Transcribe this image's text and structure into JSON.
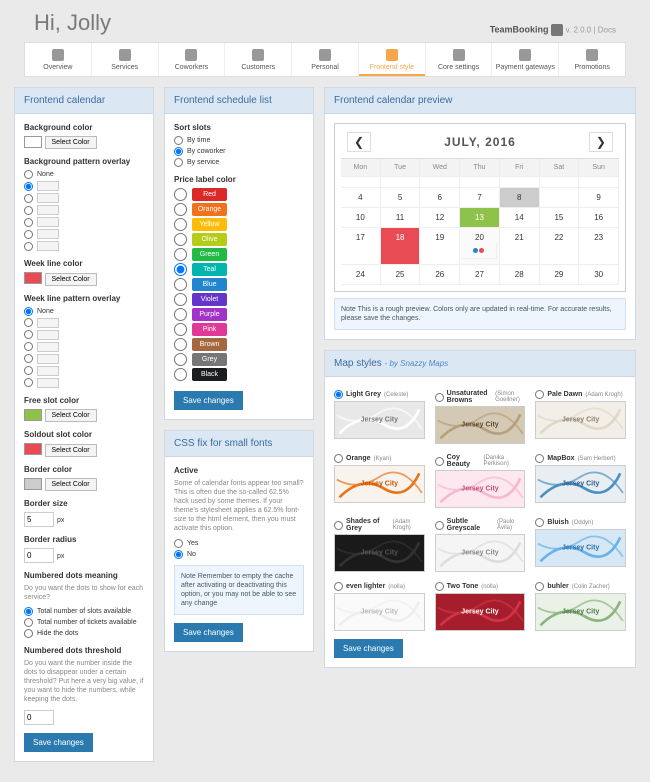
{
  "header": {
    "greeting": "Hi, Jolly",
    "brand": "TeamBooking",
    "version": "v. 2.0.0 | Docs"
  },
  "tabs": [
    "Overview",
    "Services",
    "Coworkers",
    "Customers",
    "Personal",
    "Frontend style",
    "Core settings",
    "Payment gateways",
    "Promotions"
  ],
  "activeTab": 5,
  "fcal": {
    "title": "Frontend calendar",
    "bg_label": "Background color",
    "select": "Select Color",
    "pattern_label": "Background pattern overlay",
    "none": "None",
    "wlc_label": "Week line color",
    "wlp_label": "Week line pattern overlay",
    "free_label": "Free slot color",
    "sold_label": "Soldout slot color",
    "border_label": "Border color",
    "bsize_label": "Border size",
    "bsize_val": "5",
    "px": "px",
    "brad_label": "Border radius",
    "brad_val": "0",
    "dots_label": "Numbered dots meaning",
    "dots_hint": "Do you want the dots to show for each service?",
    "dots_opts": [
      "Total number of slots available",
      "Total number of tickets available",
      "Hide the dots"
    ],
    "thresh_label": "Numbered dots threshold",
    "thresh_hint": "Do you want the number inside the dots to disappear under a certain threshold? Put here a very big value, if you want to hide the numbers, while keeping the dots.",
    "thresh_val": "0",
    "save": "Save changes"
  },
  "fsl": {
    "title": "Frontend schedule list",
    "sort_label": "Sort slots",
    "sort_opts": [
      "By time",
      "By coworker",
      "By service"
    ],
    "price_label": "Price label color",
    "colors": [
      {
        "n": "Red",
        "c": "#db2828"
      },
      {
        "n": "Orange",
        "c": "#f2711c"
      },
      {
        "n": "Yellow",
        "c": "#fbbd08"
      },
      {
        "n": "Olive",
        "c": "#b5cc18"
      },
      {
        "n": "Green",
        "c": "#21ba45"
      },
      {
        "n": "Teal",
        "c": "#00b5ad"
      },
      {
        "n": "Blue",
        "c": "#2185d0"
      },
      {
        "n": "Violet",
        "c": "#6435c9"
      },
      {
        "n": "Purple",
        "c": "#a333c8"
      },
      {
        "n": "Pink",
        "c": "#e03997"
      },
      {
        "n": "Brown",
        "c": "#a5673f"
      },
      {
        "n": "Grey",
        "c": "#767676"
      },
      {
        "n": "Black",
        "c": "#1b1c1d"
      }
    ],
    "save": "Save changes"
  },
  "css": {
    "title": "CSS fix for small fonts",
    "active_label": "Active",
    "desc": "Some of calendar fonts appear too small? This is often due the so-called 62.5% hack used by some themes. If your theme's stylesheet applies a 62.5% font-size to the html element, then you must activate this option.",
    "yes": "Yes",
    "no": "No",
    "note": "Note Remember to empty the cache after activating or deactivating this option, or you may not be able to see any change",
    "save": "Save changes"
  },
  "prev": {
    "title": "Frontend calendar preview",
    "month": "JULY, 2016",
    "days": [
      "Mon",
      "Tue",
      "Wed",
      "Thu",
      "Fri",
      "Sat",
      "Sun"
    ],
    "note": "Note This is a rough preview. Colors only are updated in real-time. For accurate results, please save the changes."
  },
  "maps": {
    "title": "Map styles",
    "by": "- by ",
    "link": "Snazzy Maps",
    "items": [
      {
        "n": "Light Grey",
        "a": "(Celeste)",
        "bg": "#e8e8e8",
        "road": "#fff",
        "tc": "#777"
      },
      {
        "n": "Unsaturated Browns",
        "a": "(Simon Goellner)",
        "bg": "#d4c9b5",
        "road": "#b5a079",
        "tc": "#5a4a30"
      },
      {
        "n": "Pale Dawn",
        "a": "(Adam Krogh)",
        "bg": "#f2efe9",
        "road": "#e0d8c7",
        "tc": "#8a826e"
      },
      {
        "n": "Orange",
        "a": "(Kyan)",
        "bg": "#f8f4ed",
        "road": "#e87419",
        "tc": "#c45500"
      },
      {
        "n": "Coy Beauty",
        "a": "(Danika Perkison)",
        "bg": "#fde8ef",
        "road": "#f5b8d0",
        "tc": "#c94b7a"
      },
      {
        "n": "MapBox",
        "a": "(Sam Herbert)",
        "bg": "#e8eef2",
        "road": "#4a90c2",
        "tc": "#2a5a8a"
      },
      {
        "n": "Shades of Grey",
        "a": "(Adam Krogh)",
        "bg": "#1a1a1a",
        "road": "#333",
        "tc": "#555"
      },
      {
        "n": "Subtle Greyscale",
        "a": "(Paulo Ávila)",
        "bg": "#f5f5f5",
        "road": "#ddd",
        "tc": "#888"
      },
      {
        "n": "Bluish",
        "a": "(Oddyn)",
        "bg": "#d6e8f5",
        "road": "#6ab1e8",
        "tc": "#2a6aa8"
      },
      {
        "n": "even lighter",
        "a": "(nolla)",
        "bg": "#fafafa",
        "road": "#eee",
        "tc": "#bbb"
      },
      {
        "n": "Two Tone",
        "a": "(nolla)",
        "bg": "#a61e2e",
        "road": "#d13545",
        "tc": "#fff"
      },
      {
        "n": "buhler",
        "a": "(Colin Zacher)",
        "bg": "#eaf2e8",
        "road": "#8ab57f",
        "tc": "#4a7a3f"
      }
    ],
    "city": "Jersey City",
    "save": "Save changes"
  }
}
